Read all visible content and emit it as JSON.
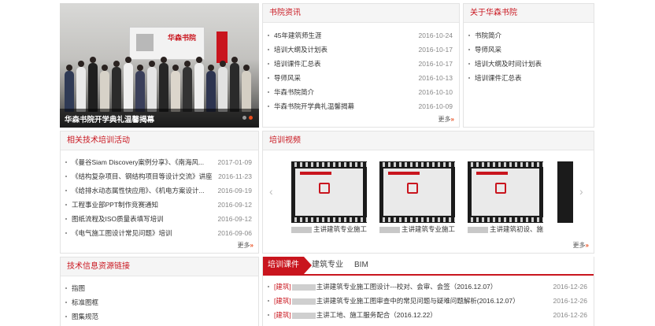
{
  "slideshow": {
    "caption": "华森书院开学典礼温馨揭幕",
    "banner_logo": "华森书院",
    "active_dot": 2,
    "dot_count": 2
  },
  "news": {
    "title": "书院资讯",
    "more": "更多",
    "items": [
      {
        "title": "45年建筑师生涯",
        "date": "2016-10-24"
      },
      {
        "title": "培训大纲及计划表",
        "date": "2016-10-17"
      },
      {
        "title": "培训课件汇总表",
        "date": "2016-10-17"
      },
      {
        "title": "导师风采",
        "date": "2016-10-13"
      },
      {
        "title": "华森书院简介",
        "date": "2016-10-10"
      },
      {
        "title": "华森书院开学典礼温馨揭幕",
        "date": "2016-10-09"
      }
    ]
  },
  "about": {
    "title": "关于华森书院",
    "items": [
      "书院简介",
      "导师风采",
      "培训大纲及时间计划表",
      "培训课件汇总表"
    ]
  },
  "activities": {
    "title": "相关技术培训活动",
    "more": "更多",
    "items": [
      {
        "title": "《曼谷Siam Discovery案例分享》、《南海风...",
        "date": "2017-01-09"
      },
      {
        "title": "《结构复杂项目、钢结构项目等设计交流》讲座",
        "date": "2016-11-23"
      },
      {
        "title": "《给排水动态属性快应用》、《机电方案设计...",
        "date": "2016-09-19"
      },
      {
        "title": "工程事业部PPT制作竞赛通知",
        "date": "2016-09-12"
      },
      {
        "title": "图纸流程及ISO质量表填写培训",
        "date": "2016-09-12"
      },
      {
        "title": "《电气施工图设计常见问题》培训",
        "date": "2016-09-06"
      }
    ]
  },
  "videos": {
    "title": "培训视频",
    "more": "更多",
    "prev_icon": "chevron-left-icon",
    "next_icon": "chevron-right-icon",
    "items": [
      {
        "label": "主讲建筑专业施工..."
      },
      {
        "label": "主讲建筑专业施工..."
      },
      {
        "label": "主讲建筑初设、施..."
      }
    ]
  },
  "links": {
    "title": "技术信息资源链接",
    "items": [
      "指图",
      "标准图框",
      "图集规范"
    ]
  },
  "courseware": {
    "tabs": [
      "培训课件",
      "建筑专业",
      "BIM"
    ],
    "active_tab": 0,
    "items": [
      {
        "tag": "[建筑]",
        "title": "主讲建筑专业施工图设计---校对、会审、会签（2016.12.07）",
        "date": "2016-12-26"
      },
      {
        "tag": "[建筑]",
        "title": "主讲建筑专业施工图审查中的常见问题与疑难问题解析(2016.12.07）",
        "date": "2016-12-26"
      },
      {
        "tag": "[建筑]",
        "title": "主讲工地、施工服务配合（2016.12.22）",
        "date": "2016-12-26"
      }
    ]
  }
}
